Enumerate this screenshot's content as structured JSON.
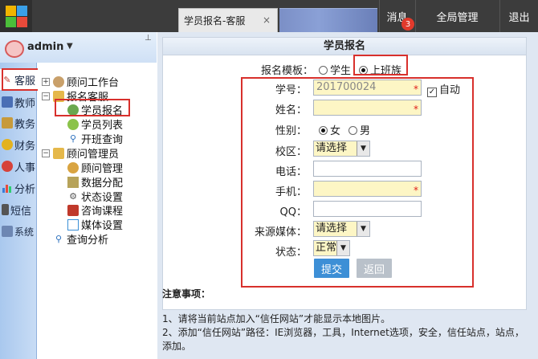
{
  "header": {
    "tab_title": "学员报名-客服",
    "tab_close": "×",
    "messages_label": "消息",
    "messages_count": "3",
    "global_label": "全局管理",
    "logout_label": "退出"
  },
  "user": {
    "name": "admin",
    "caret": "▼",
    "pin": "⊥"
  },
  "modules": [
    {
      "label": "客服",
      "icon": "pencil-icon"
    },
    {
      "label": "教师",
      "icon": "teacher-icon"
    },
    {
      "label": "教务",
      "icon": "academic-icon"
    },
    {
      "label": "财务",
      "icon": "finance-icon"
    },
    {
      "label": "人事",
      "icon": "hr-icon"
    },
    {
      "label": "分析",
      "icon": "chart-icon"
    },
    {
      "label": "短信",
      "icon": "sms-icon"
    },
    {
      "label": "系统",
      "icon": "system-icon"
    }
  ],
  "tree": {
    "n0": "顾问工作台",
    "n1": "报名客服",
    "n2": "学员报名",
    "n3": "学员列表",
    "n4": "开班查询",
    "n5": "顾问管理员",
    "n6": "顾问管理",
    "n7": "数据分配",
    "n8": "状态设置",
    "n9": "咨询课程",
    "n10": "媒体设置",
    "n11": "查询分析"
  },
  "form": {
    "title": "学员报名",
    "template_label": "报名模板：",
    "template_opt1": "学生",
    "template_opt2": "上班族",
    "student_id_label": "学号：",
    "student_id_value": "201700024",
    "auto_label": "自动",
    "name_label": "姓名：",
    "gender_label": "性别：",
    "gender_female": "女",
    "gender_male": "男",
    "campus_label": "校区：",
    "campus_value": "请选择",
    "phone_label": "电话：",
    "mobile_label": "手机：",
    "qq_label": "QQ：",
    "source_label": "来源媒体：",
    "source_value": "请选择",
    "status_label": "状态：",
    "status_value": "正常",
    "submit_label": "提交",
    "back_label": "返回",
    "required_mark": "*"
  },
  "notes": {
    "title": "注意事项：",
    "line1": "1、请将当前站点加入“信任网站”才能显示本地图片。",
    "line2": "2、添加“信任网站”路径：IE浏览器，工具，Internet选项，安全，信任站点，站点，添加。"
  },
  "colors": {
    "topbar": "#3c3c3c",
    "required_bg": "#fdf6c5",
    "highlight_red": "#d8302c",
    "submit_bg": "#3d8fd6",
    "back_bg": "#b9c1ca"
  }
}
